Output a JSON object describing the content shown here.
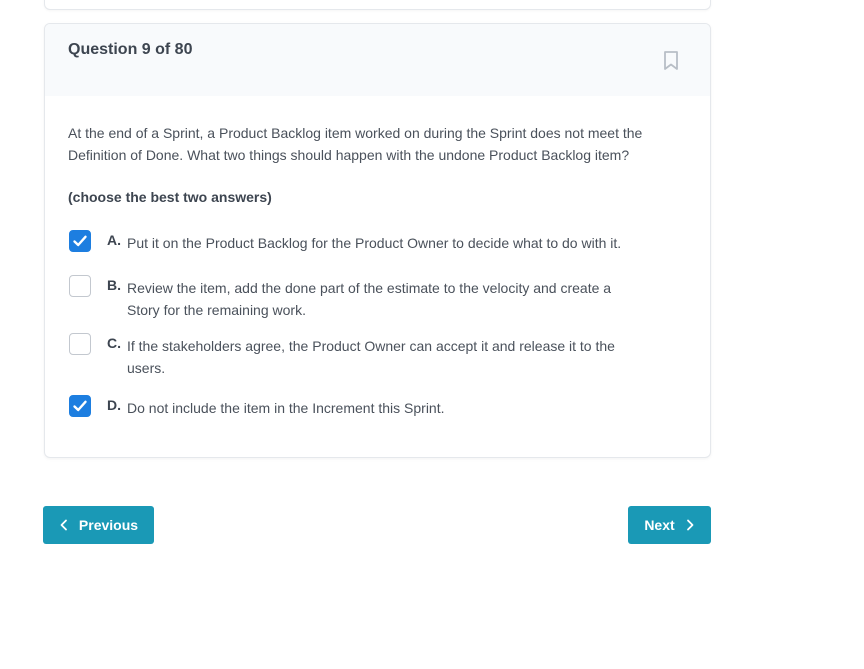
{
  "question": {
    "title": "Question 9 of 80",
    "text": "At the end of a Sprint, a Product Backlog item worked on during the Sprint does not meet the Definition of Done. What two things should happen with the undone Product Backlog item?",
    "hint": "(choose the best two answers)",
    "bookmark_icon": "bookmark-icon",
    "options": [
      {
        "letter": "A.",
        "text": "Put it on the Product Backlog for the Product Owner to decide what to do with it.",
        "checked": true
      },
      {
        "letter": "B.",
        "text": "Review the item, add the done part of the estimate to the velocity and create a Story for the remaining work.",
        "checked": false
      },
      {
        "letter": "C.",
        "text": "If the stakeholders agree, the Product Owner can accept it and release it to the users.",
        "checked": false
      },
      {
        "letter": "D.",
        "text": "Do not include the item in the Increment this Sprint.",
        "checked": true
      }
    ]
  },
  "navigation": {
    "previous_label": "Previous",
    "next_label": "Next"
  },
  "colors": {
    "accent": "#1a99b6",
    "checkbox_checked": "#1d7ee0"
  }
}
